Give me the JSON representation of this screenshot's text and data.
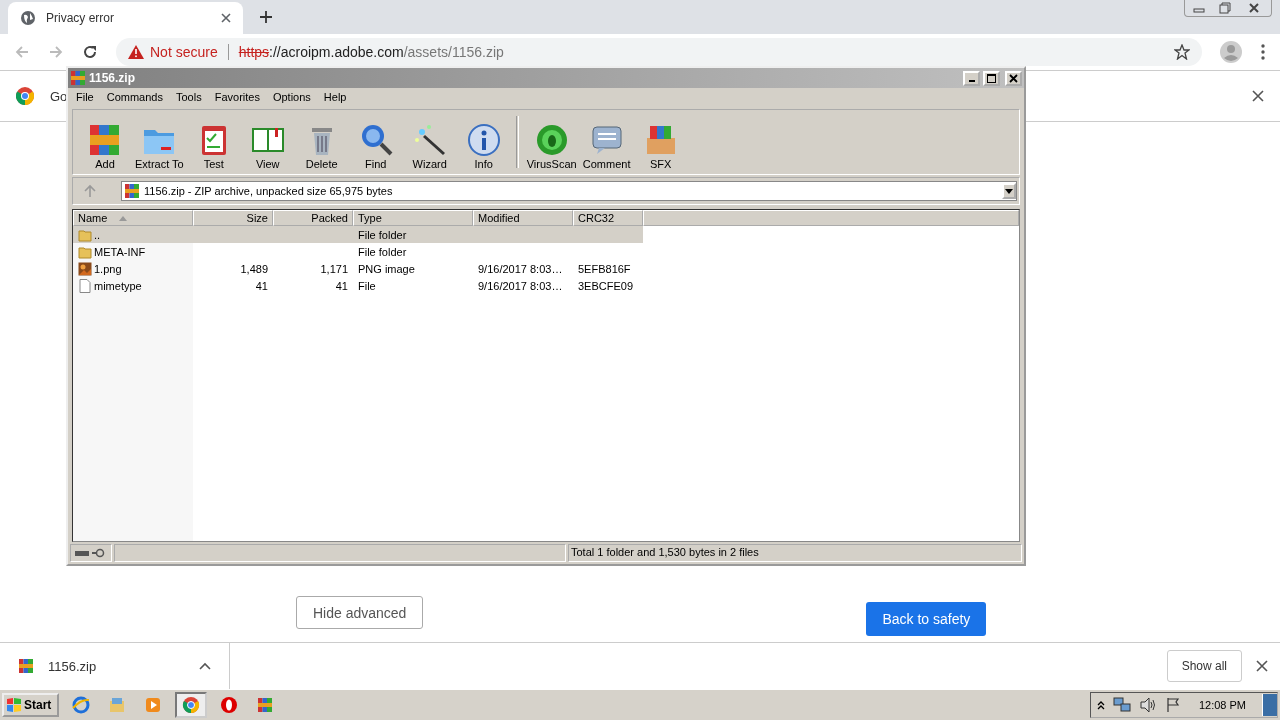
{
  "browser": {
    "tab": {
      "title": "Privacy error",
      "selected": true
    },
    "address": {
      "security": "Not secure",
      "scheme": "https",
      "host": "://acroipm.adobe.com",
      "path": "/assets/1156.zip"
    },
    "infobar": {
      "text": "Go"
    },
    "page": {
      "buttons": [
        {
          "label": "Hide advanced",
          "kind": "secondary"
        },
        {
          "label": "Back to safety",
          "kind": "primary"
        }
      ]
    },
    "download": {
      "file": "1156.zip",
      "show_all": "Show all"
    }
  },
  "winrar": {
    "title": "1156.zip",
    "menu": [
      "File",
      "Commands",
      "Tools",
      "Favorites",
      "Options",
      "Help"
    ],
    "toolbar": [
      {
        "label": "Add",
        "kind": "add"
      },
      {
        "label": "Extract To",
        "kind": "extract"
      },
      {
        "label": "Test",
        "kind": "test"
      },
      {
        "label": "View",
        "kind": "view"
      },
      {
        "label": "Delete",
        "kind": "delete"
      },
      {
        "label": "Find",
        "kind": "find"
      },
      {
        "label": "Wizard",
        "kind": "wizard"
      },
      {
        "label": "Info",
        "kind": "info"
      },
      {
        "label": "VirusScan",
        "kind": "virus"
      },
      {
        "label": "Comment",
        "kind": "comment"
      },
      {
        "label": "SFX",
        "kind": "sfx"
      }
    ],
    "path": "1156.zip - ZIP archive, unpacked size 65,975 bytes",
    "columns": [
      "Name",
      "Size",
      "Packed",
      "Type",
      "Modified",
      "CRC32"
    ],
    "rows": [
      {
        "kind": "folder",
        "selected": true,
        "cells": [
          "..",
          "",
          "",
          "File folder",
          "",
          ""
        ]
      },
      {
        "kind": "folder",
        "selected": false,
        "cells": [
          "META-INF",
          "",
          "",
          "File folder",
          "",
          ""
        ]
      },
      {
        "kind": "image",
        "selected": false,
        "cells": [
          "1.png",
          "1,489",
          "1,171",
          "PNG image",
          "9/16/2017 8:03…",
          "5EFB816F"
        ]
      },
      {
        "kind": "file",
        "selected": false,
        "cells": [
          "mimetype",
          "41",
          "41",
          "File",
          "9/16/2017 8:03…",
          "3EBCFE09"
        ]
      }
    ],
    "status": "Total 1 folder and 1,530 bytes in 2 files"
  },
  "taskbar": {
    "start": "Start",
    "items": [
      {
        "kind": "ie",
        "selected": false
      },
      {
        "kind": "explorer",
        "selected": false
      },
      {
        "kind": "media",
        "selected": false
      },
      {
        "kind": "chrome",
        "selected": true
      },
      {
        "kind": "opera",
        "selected": false
      },
      {
        "kind": "winrar",
        "selected": false
      }
    ],
    "clock": "12:08 PM"
  }
}
